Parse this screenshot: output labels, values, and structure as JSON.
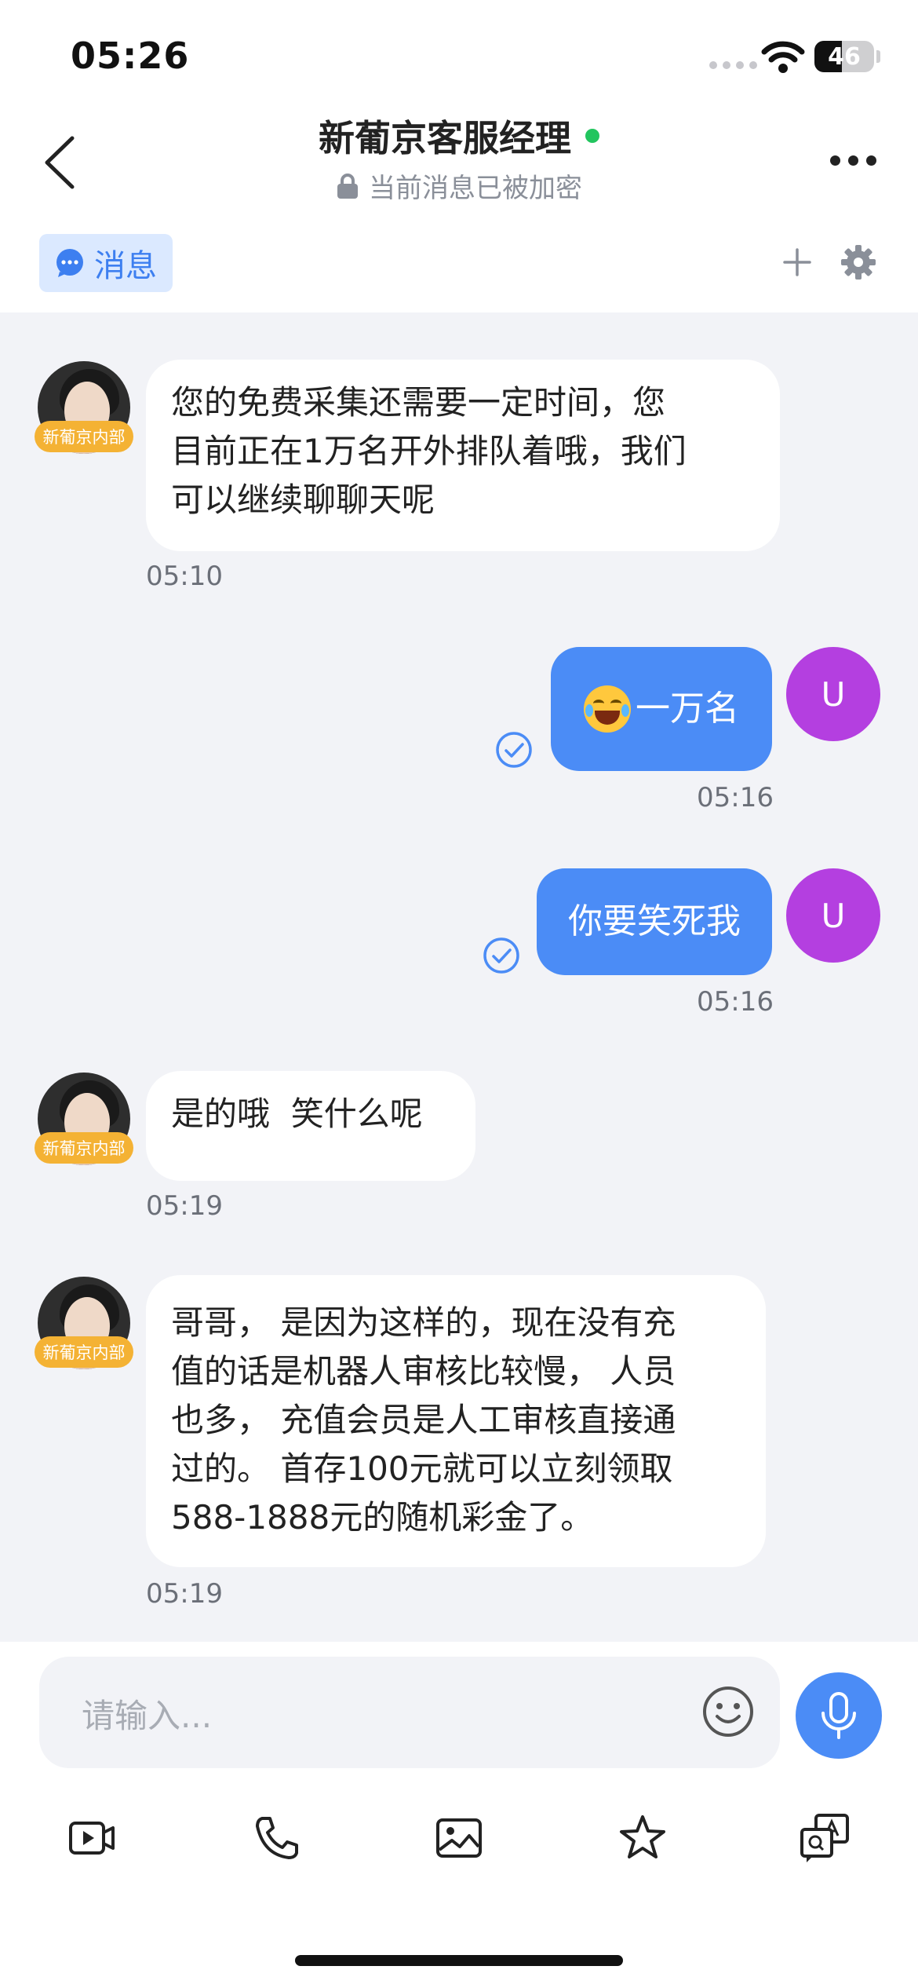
{
  "status_bar": {
    "time": "05:26",
    "battery": "46",
    "battery_level_percent": 46
  },
  "header": {
    "title": "新葡京客服经理",
    "subtitle": "当前消息已被加密"
  },
  "tabs": {
    "messages_label": "消息"
  },
  "agent": {
    "badge": "新葡京内部"
  },
  "user": {
    "avatar_letter": "U"
  },
  "messages": [
    {
      "side": "left",
      "lines": [
        "您的免费采集还需要一定时间，您",
        "目前正在1万名开外排队着哦，我们",
        "可以继续聊聊天呢"
      ],
      "time": "05:10"
    },
    {
      "side": "right",
      "text": "一万名",
      "emoji": "face-with-tears-of-joy",
      "time": "05:16"
    },
    {
      "side": "right",
      "text": "你要笑死我",
      "time": "05:16"
    },
    {
      "side": "left",
      "lines": [
        "是的哦  笑什么呢"
      ],
      "time": "05:19"
    },
    {
      "side": "left",
      "lines": [
        "哥哥， 是因为这样的，现在没有充",
        "值的话是机器人审核比较慢， 人员",
        "也多， 充值会员是人工审核直接通",
        "过的。 首存100元就可以立刻领取",
        "588-1888元的随机彩金了。"
      ],
      "time": "05:19"
    }
  ],
  "composer": {
    "placeholder": "请输入..."
  },
  "toolbar": {
    "icons": [
      "video-icon",
      "phone-icon",
      "image-icon",
      "star-icon",
      "translate-icon"
    ]
  },
  "colors": {
    "accent": "#4b8cf6",
    "user_avatar": "#b43fe0",
    "badge": "#f4b234",
    "online": "#22c55e"
  }
}
